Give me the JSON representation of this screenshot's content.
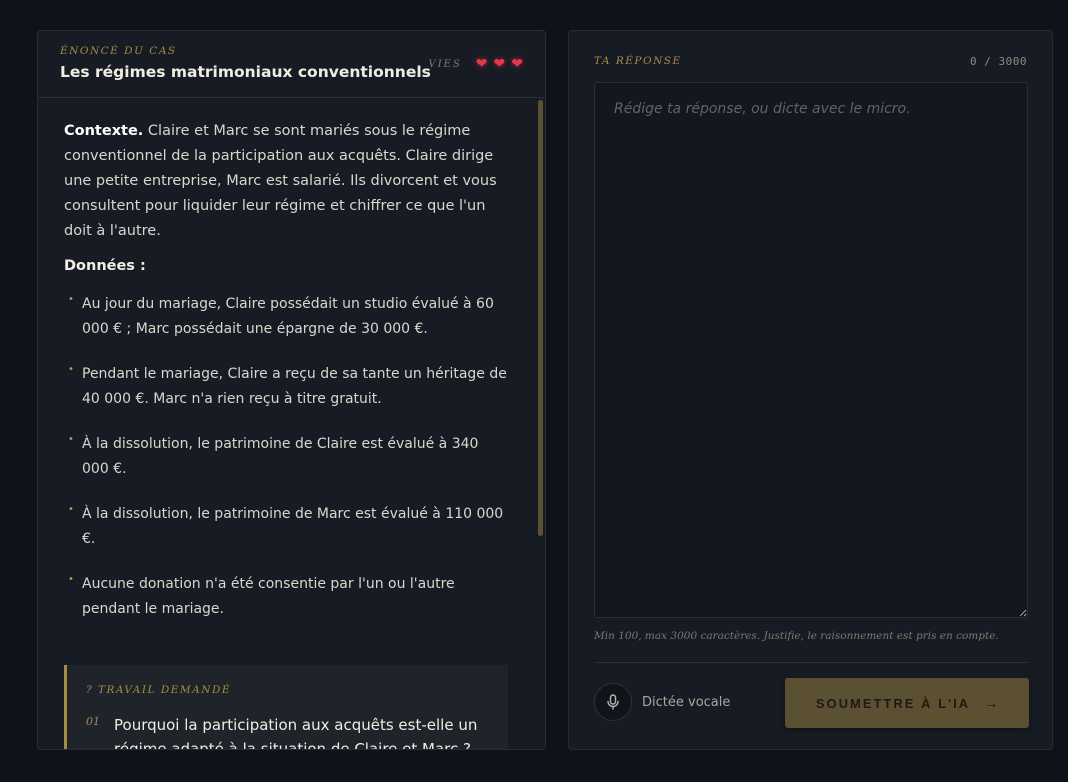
{
  "case": {
    "eyebrow": "ÉNONCÉ DU CAS",
    "title": "Les régimes matrimoniaux conventionnels",
    "lives_label": "VIES",
    "lives": [
      "❤",
      "❤",
      "❤"
    ]
  },
  "statement": {
    "context_label": "Contexte.",
    "context_text": " Claire et Marc se sont mariés sous le régime conventionnel de la participation aux acquêts. Claire dirige une petite entreprise, Marc est salarié. Ils divorcent et vous consultent pour liquider leur régime et chiffrer ce que l'un doit à l'autre.",
    "data_title": "Données :",
    "bullets": [
      "Au jour du mariage, Claire possédait un studio évalué à 60 000 € ; Marc possédait une épargne de 30 000 €.",
      "Pendant le mariage, Claire a reçu de sa tante un héritage de 40 000 €. Marc n'a rien reçu à titre gratuit.",
      "À la dissolution, le patrimoine de Claire est évalué à 340 000 €.",
      "À la dissolution, le patrimoine de Marc est évalué à 110 000 €.",
      "Aucune donation n'a été consentie par l'un ou l'autre pendant le mariage."
    ]
  },
  "task": {
    "eyebrow": "? TRAVAIL DEMANDÉ",
    "items": [
      {
        "num": "01",
        "text": "Pourquoi la participation aux acquêts est-elle un régime adapté à la situation de Claire et Marc ?"
      }
    ]
  },
  "answer": {
    "label": "TA RÉPONSE",
    "counter": "0 / 3000",
    "placeholder": "Rédige ta réponse, ou dicte avec le micro.",
    "hint": "Min 100, max 3000 caractères. Justifie, le raisonnement est pris en compte.",
    "voice_label": "Dictée vocale",
    "submit_label": "SOUMETTRE À L'IA",
    "submit_arrow": "→"
  },
  "colors": {
    "accent": "#a58b45",
    "heart": "#e5384a",
    "submit_bg": "#5c5032"
  }
}
